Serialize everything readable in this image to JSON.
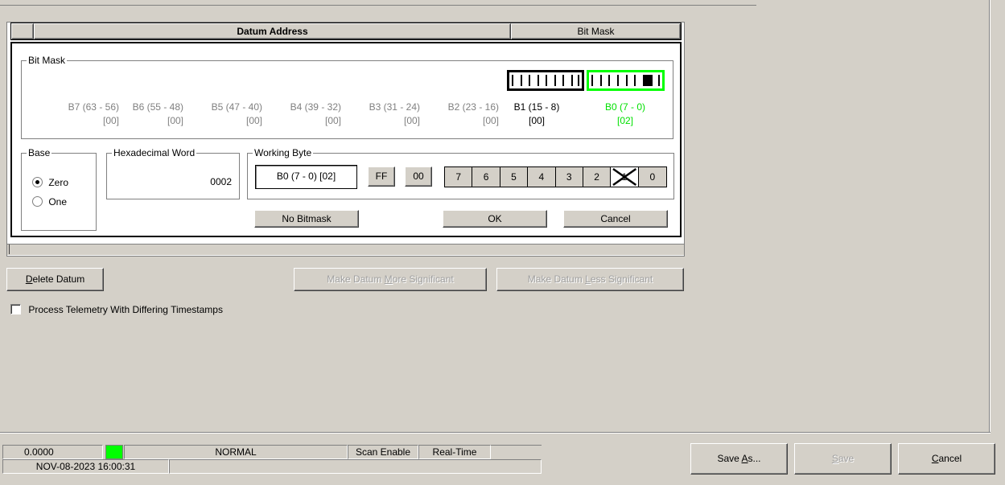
{
  "header": {
    "datum_address": "Datum Address",
    "bit_mask": "Bit Mask"
  },
  "bitmask_group": {
    "label": "Bit Mask",
    "bytes": [
      {
        "name": "B7 (63 - 56)",
        "value": "[00]"
      },
      {
        "name": "B6 (55 - 48)",
        "value": "[00]"
      },
      {
        "name": "B5 (47 - 40)",
        "value": "[00]"
      },
      {
        "name": "B4 (39 - 32)",
        "value": "[00]"
      },
      {
        "name": "B3 (31 - 24)",
        "value": "[00]"
      },
      {
        "name": "B2 (23 - 16)",
        "value": "[00]"
      },
      {
        "name": "B1 (15 - 8)",
        "value": "[00]"
      },
      {
        "name": "B0 (7 - 0)",
        "value": "[02]"
      }
    ]
  },
  "base": {
    "label": "Base",
    "zero": "Zero",
    "one": "One",
    "selected": "Zero"
  },
  "hex_word": {
    "label": "Hexadecimal Word",
    "value": "0002"
  },
  "working_byte": {
    "label": "Working Byte",
    "value": "B0 (7 - 0) [02]",
    "ff": "FF",
    "zero_zero": "00",
    "bits": [
      "7",
      "6",
      "5",
      "4",
      "3",
      "2",
      "1",
      "0"
    ],
    "checked_bit": "1"
  },
  "buttons": {
    "no_bitmask": "No Bitmask",
    "ok": "OK",
    "cancel": "Cancel",
    "delete_datum_u": "D",
    "delete_datum_rest": "elete Datum",
    "more_sig_a": "Make Datum ",
    "more_sig_u": "M",
    "more_sig_b": "ore Significant",
    "less_sig_a": "Make Datum ",
    "less_sig_u": "L",
    "less_sig_b": "ess Significant"
  },
  "checkbox": {
    "label": "Process Telemetry With Differing Timestamps",
    "checked": false
  },
  "status": {
    "value": "0.0000",
    "indicator_color": "#00ff00",
    "mode": "NORMAL",
    "scan": "Scan Enable",
    "realtime": "Real-Time",
    "timestamp": "NOV-08-2023 16:00:31"
  },
  "footer": {
    "save_as_a": "Save ",
    "save_as_u": "A",
    "save_as_b": "s...",
    "save_u": "S",
    "save_b": "ave",
    "cancel_u": "C",
    "cancel_b": "ancel"
  },
  "colors": {
    "accent_green": "#00ff00",
    "background": "#d4d0c8"
  }
}
